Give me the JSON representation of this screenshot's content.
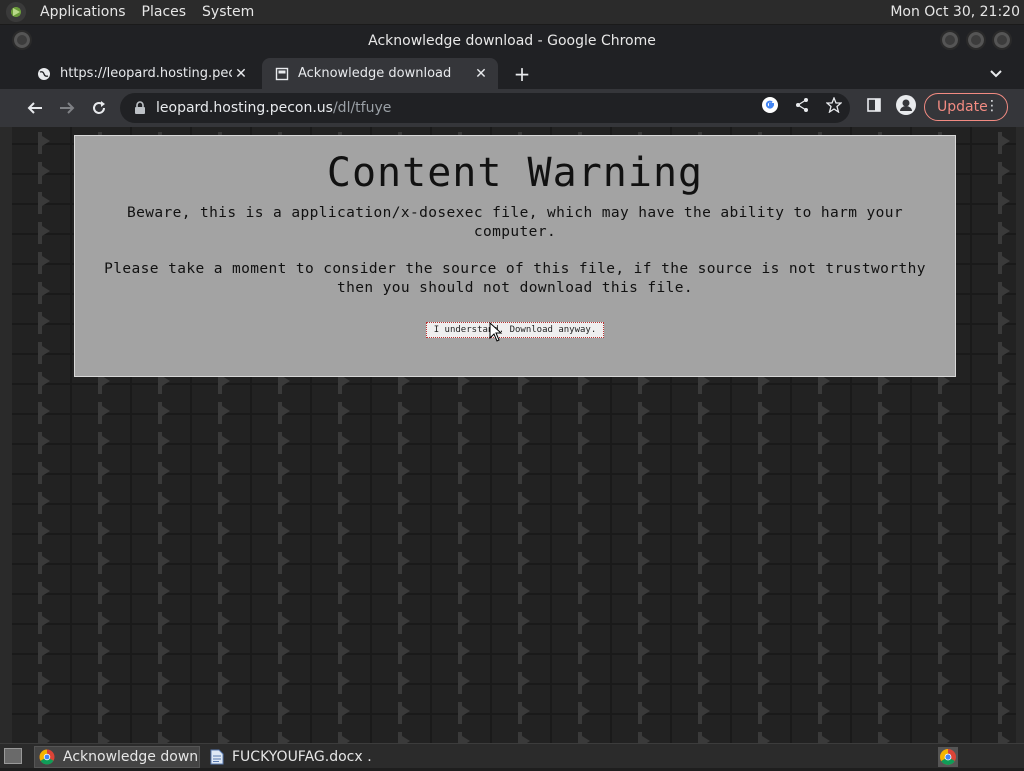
{
  "top_panel": {
    "menus": [
      "Applications",
      "Places",
      "System"
    ],
    "clock": "Mon Oct 30, 21:20"
  },
  "window": {
    "title": "Acknowledge download - Google Chrome"
  },
  "tabs": [
    {
      "label": "https://leopard.hosting.pecon.us/dl/tfuye",
      "icon": "globe-icon",
      "active": false
    },
    {
      "label": "Acknowledge download",
      "icon": "page-icon",
      "active": true
    }
  ],
  "toolbar": {
    "url_host": "leopard.hosting.pecon.us",
    "url_path": "/dl/tfuye",
    "update_label": "Update"
  },
  "page": {
    "heading": "Content Warning",
    "warning_text": "Beware, this is a application/x-dosexec file, which may have the ability to harm your computer.",
    "advice_text": "Please take a moment to consider the source of this file, if the source is not trustworthy then you should not download this file.",
    "download_button": "I understand. Download anyway."
  },
  "taskbar": {
    "tasks": [
      {
        "label": "Acknowledge down…",
        "icon": "chrome-icon",
        "active": true
      },
      {
        "label": "FUCKYOUFAG.docx …",
        "icon": "document-icon",
        "active": false
      }
    ]
  },
  "colors": {
    "update_accent": "#f28b82",
    "panel_bg": "#a3a3a3",
    "chrome_dark": "#202124"
  }
}
